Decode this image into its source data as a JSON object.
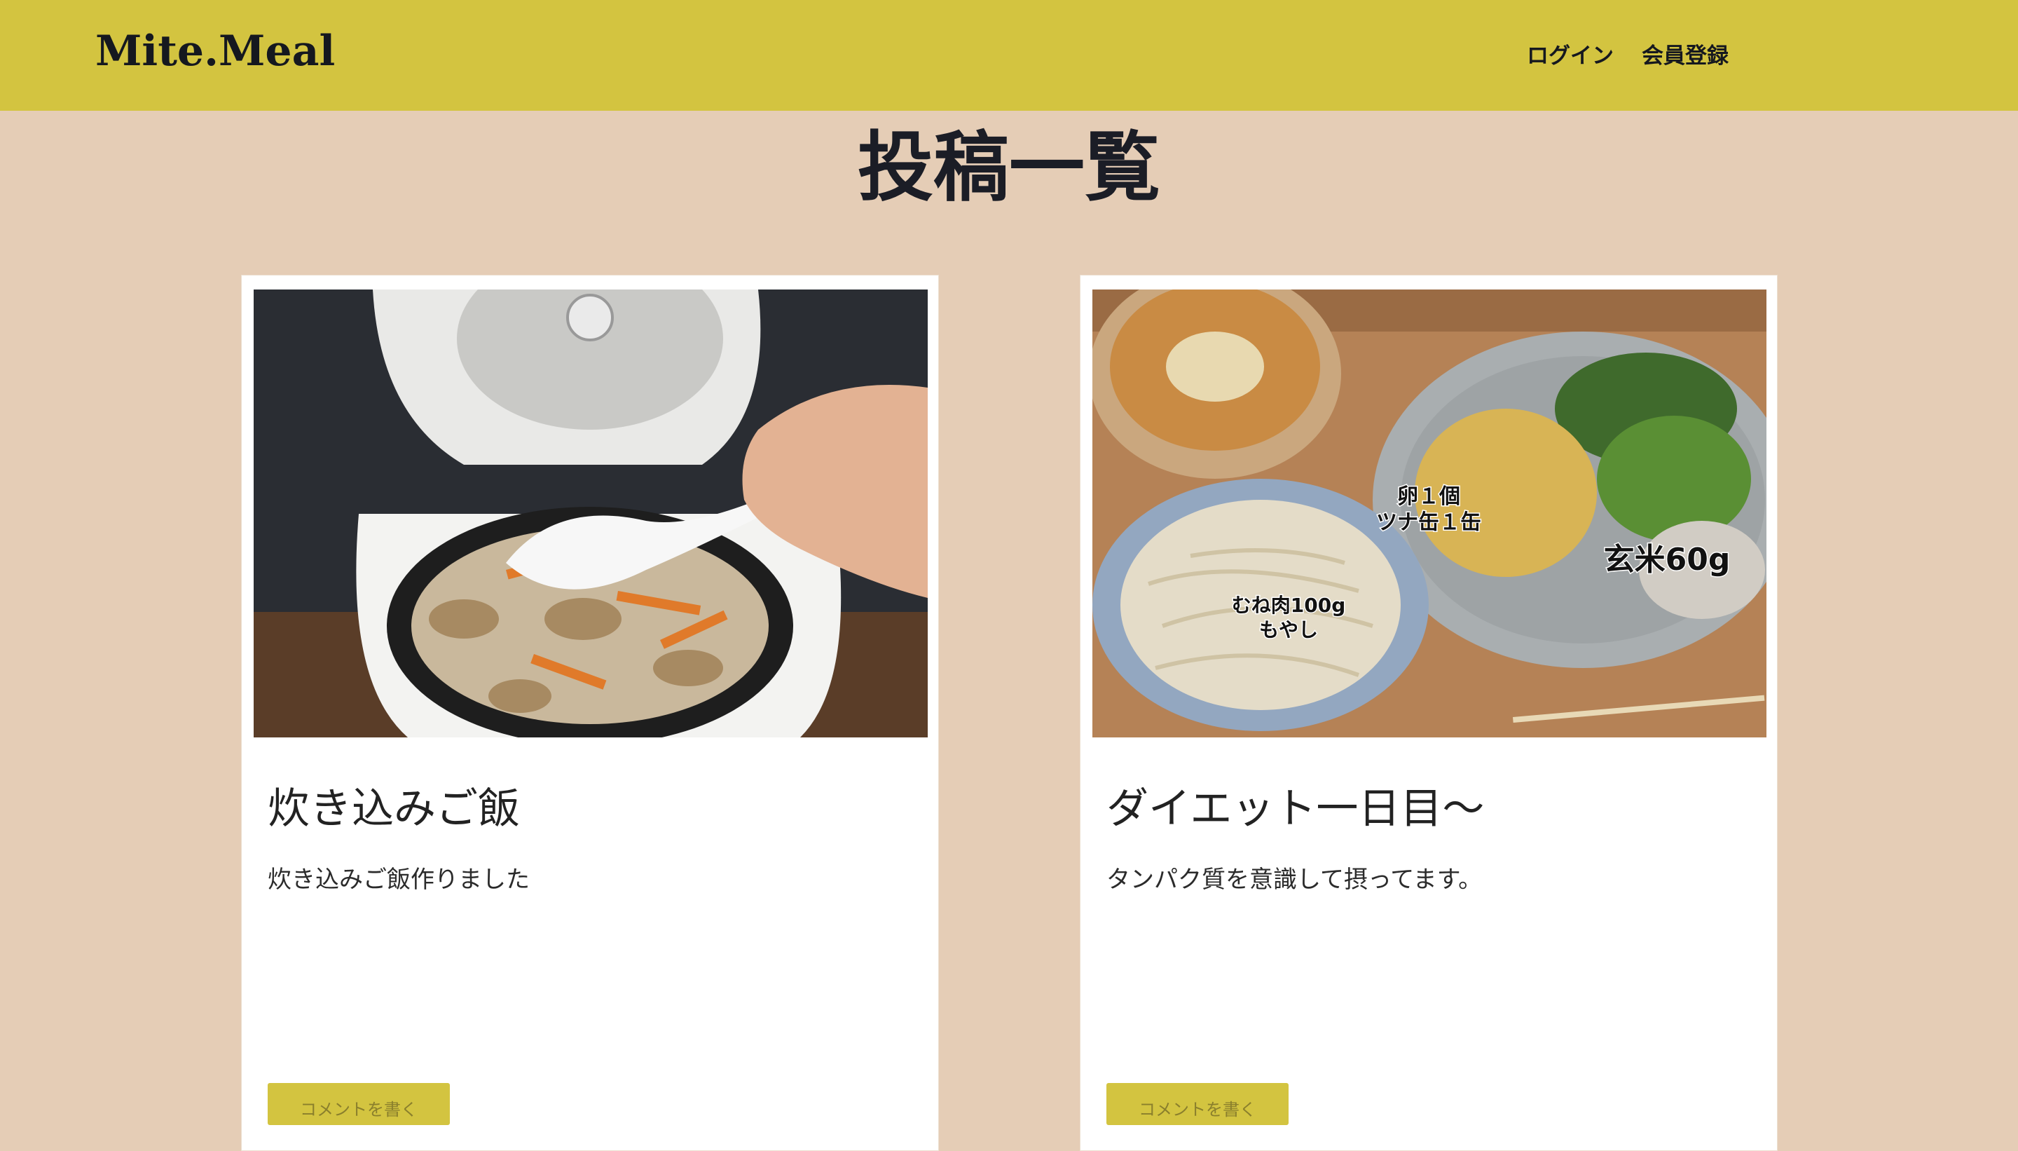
{
  "header": {
    "logo": "Mite.Meal",
    "nav": {
      "login": "ログイン",
      "register": "会員登録"
    }
  },
  "main": {
    "page_title": "投稿一覧",
    "posts": [
      {
        "title": "炊き込みご飯",
        "body": "炊き込みご飯作りました",
        "comment_button": "コメントを書く",
        "image_label": ""
      },
      {
        "title": "ダイエット一日目〜",
        "body": "タンパク質を意識して摂ってます。",
        "comment_button": "コメントを書く",
        "photo_labels": {
          "egg_tuna_line1": "卵１個",
          "egg_tuna_line2": "ツナ缶１缶",
          "rice": "玄米60g",
          "chicken_line1": "むね肉100g",
          "chicken_line2": "もやし"
        }
      }
    ]
  },
  "colors": {
    "header_bg": "#d3c440",
    "page_bg": "#e5cdb6",
    "card_bg": "#ffffff",
    "button_bg": "#d3c440"
  }
}
